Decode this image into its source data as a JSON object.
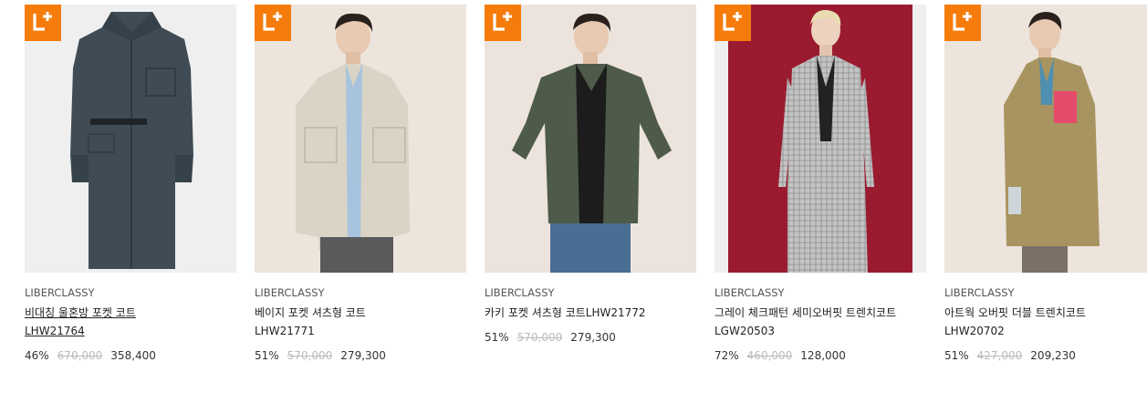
{
  "products": [
    {
      "brand": "LIBERCLASSY",
      "name": "비대칭 울혼방 포켓 코트",
      "code": "LHW21764",
      "discount": "46%",
      "original_price": "670,000",
      "price": "358,400",
      "badge": "L+",
      "bg_color": "#efefef",
      "coat_color": "#3f4c55"
    },
    {
      "brand": "LIBERCLASSY",
      "name": "베이지 포켓 셔츠형 코트",
      "code": "LHW21771",
      "discount": "51%",
      "original_price": "570,000",
      "price": "279,300",
      "badge": "L+",
      "bg_color": "#ede4dc",
      "coat_color": "#d9d4c6"
    },
    {
      "brand": "LIBERCLASSY",
      "name": "카키 포켓 셔츠형 코트LHW21772",
      "code": "",
      "discount": "51%",
      "original_price": "570,000",
      "price": "279,300",
      "badge": "L+",
      "bg_color": "#ece4dc",
      "coat_color": "#4e5a4a"
    },
    {
      "brand": "LIBERCLASSY",
      "name": "그레이 체크패턴 세미오버핏 트렌치코트",
      "code": "LGW20503",
      "discount": "72%",
      "original_price": "460,000",
      "price": "128,000",
      "badge": "L+",
      "bg_color": "#9a1b30",
      "coat_color": "#b9b9b9"
    },
    {
      "brand": "LIBERCLASSY",
      "name": "아트웍 오버핏 더블 트렌치코트",
      "code": "LHW20702",
      "discount": "51%",
      "original_price": "427,000",
      "price": "209,230",
      "badge": "L+",
      "bg_color": "#ede4dc",
      "coat_color": "#a89460"
    }
  ]
}
